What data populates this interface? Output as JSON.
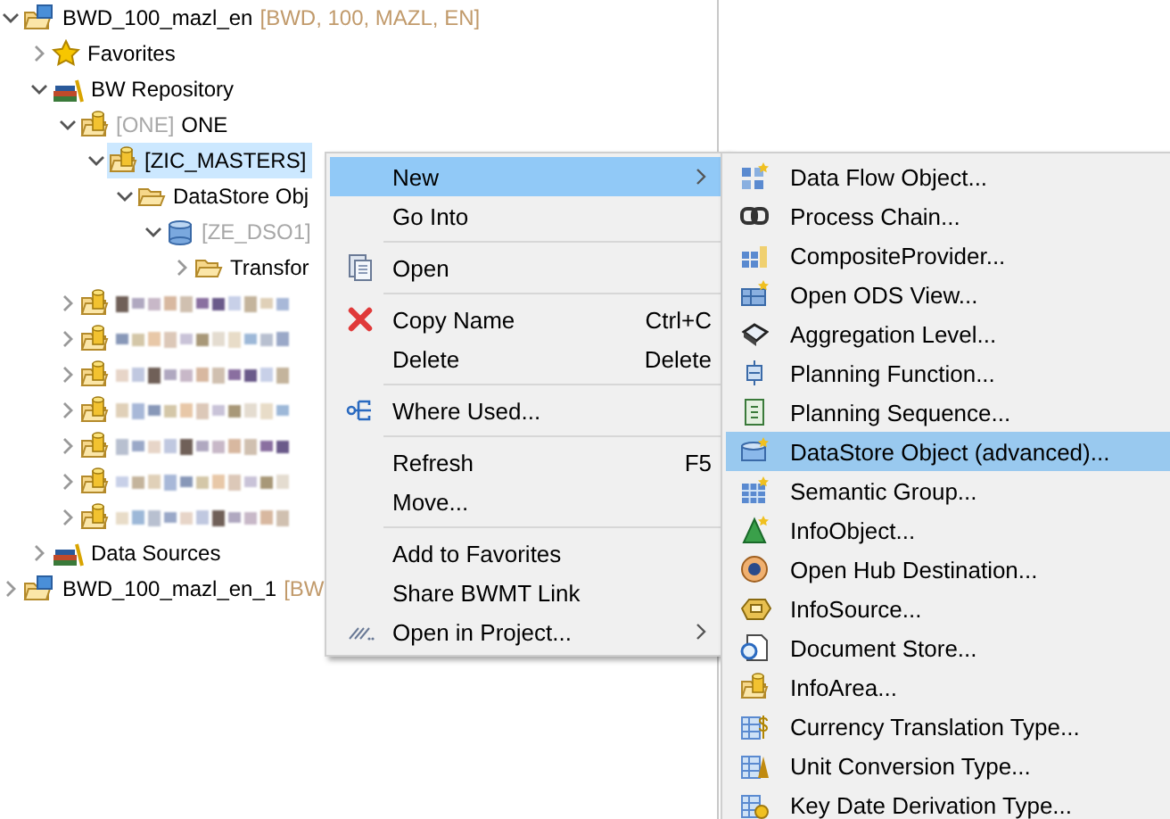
{
  "tree": {
    "items": [
      {
        "kind": "system",
        "label": "BWD_100_mazl_en",
        "detail": "[BWD, 100, MAZL, EN]",
        "expanded": true,
        "selected": false,
        "children": [
          {
            "kind": "favorites",
            "label": "Favorites",
            "expanded": false,
            "selected": false
          },
          {
            "kind": "repository",
            "label": "BW Repository",
            "expanded": true,
            "selected": false,
            "children": [
              {
                "kind": "infoarea",
                "prefix": "[ONE]",
                "label": "ONE",
                "expanded": true,
                "selected": false,
                "children": [
                  {
                    "kind": "infoarea",
                    "label": "[ZIC_MASTERS]",
                    "expanded": true,
                    "selected": true,
                    "children": [
                      {
                        "kind": "folder",
                        "label": "DataStore Obj",
                        "expanded": true,
                        "selected": false,
                        "children": [
                          {
                            "kind": "datastore",
                            "prefix": "[ZE_DSO1]",
                            "expanded": true,
                            "selected": false,
                            "children": [
                              {
                                "kind": "folder",
                                "label": "Transfor",
                                "expanded": false,
                                "selected": false
                              }
                            ]
                          }
                        ]
                      }
                    ]
                  }
                ]
              },
              {
                "kind": "obscured",
                "expanded": false,
                "selected": false
              },
              {
                "kind": "obscured",
                "expanded": false,
                "selected": false
              },
              {
                "kind": "obscured",
                "expanded": false,
                "selected": false
              },
              {
                "kind": "obscured",
                "expanded": false,
                "selected": false
              },
              {
                "kind": "obscured",
                "expanded": false,
                "selected": false
              },
              {
                "kind": "obscured",
                "expanded": false,
                "selected": false
              },
              {
                "kind": "obscured",
                "expanded": false,
                "selected": false
              }
            ]
          },
          {
            "kind": "repository",
            "label": "Data Sources",
            "expanded": false,
            "selected": false
          }
        ]
      },
      {
        "kind": "system",
        "label": "BWD_100_mazl_en_1",
        "detail": "[BW",
        "expanded": false,
        "selected": false
      }
    ]
  },
  "context_menu": {
    "groups": [
      [
        {
          "label": "New",
          "selected": true,
          "submenu": true
        },
        {
          "label": "Go Into",
          "selected": false
        }
      ],
      [
        {
          "label": "Open",
          "selected": false
        }
      ],
      [
        {
          "label": "Copy Name",
          "shortcut": "Ctrl+C",
          "selected": false
        },
        {
          "label": "Delete",
          "shortcut": "Delete",
          "selected": false
        }
      ],
      [
        {
          "label": "Where Used...",
          "selected": false
        }
      ],
      [
        {
          "label": "Refresh",
          "shortcut": "F5",
          "selected": false
        },
        {
          "label": "Move...",
          "selected": false
        }
      ],
      [
        {
          "label": "Add to Favorites",
          "selected": false
        },
        {
          "label": "Share BWMT Link",
          "selected": false
        },
        {
          "label": "Open in Project...",
          "selected": false,
          "submenu": true
        }
      ]
    ]
  },
  "submenu": {
    "groups": [
      [
        {
          "label": "Data Flow Object...",
          "selected": false
        },
        {
          "label": "Process Chain...",
          "selected": false
        },
        {
          "label": "CompositeProvider...",
          "selected": false
        },
        {
          "label": "Open ODS View...",
          "selected": false
        },
        {
          "label": "Aggregation Level...",
          "selected": false
        },
        {
          "label": "Planning Function...",
          "selected": false
        },
        {
          "label": "Planning Sequence...",
          "selected": false
        },
        {
          "label": "DataStore Object (advanced)...",
          "selected": true
        },
        {
          "label": "Semantic Group...",
          "selected": false
        },
        {
          "label": "InfoObject...",
          "selected": false
        },
        {
          "label": "Open Hub Destination...",
          "selected": false
        },
        {
          "label": "InfoSource...",
          "selected": false
        },
        {
          "label": "Document Store...",
          "selected": false
        },
        {
          "label": "InfoArea...",
          "selected": false
        },
        {
          "label": "Currency Translation Type...",
          "selected": false
        },
        {
          "label": "Unit Conversion Type...",
          "selected": false
        },
        {
          "label": "Key Date Derivation Type...",
          "selected": false
        }
      ]
    ]
  }
}
